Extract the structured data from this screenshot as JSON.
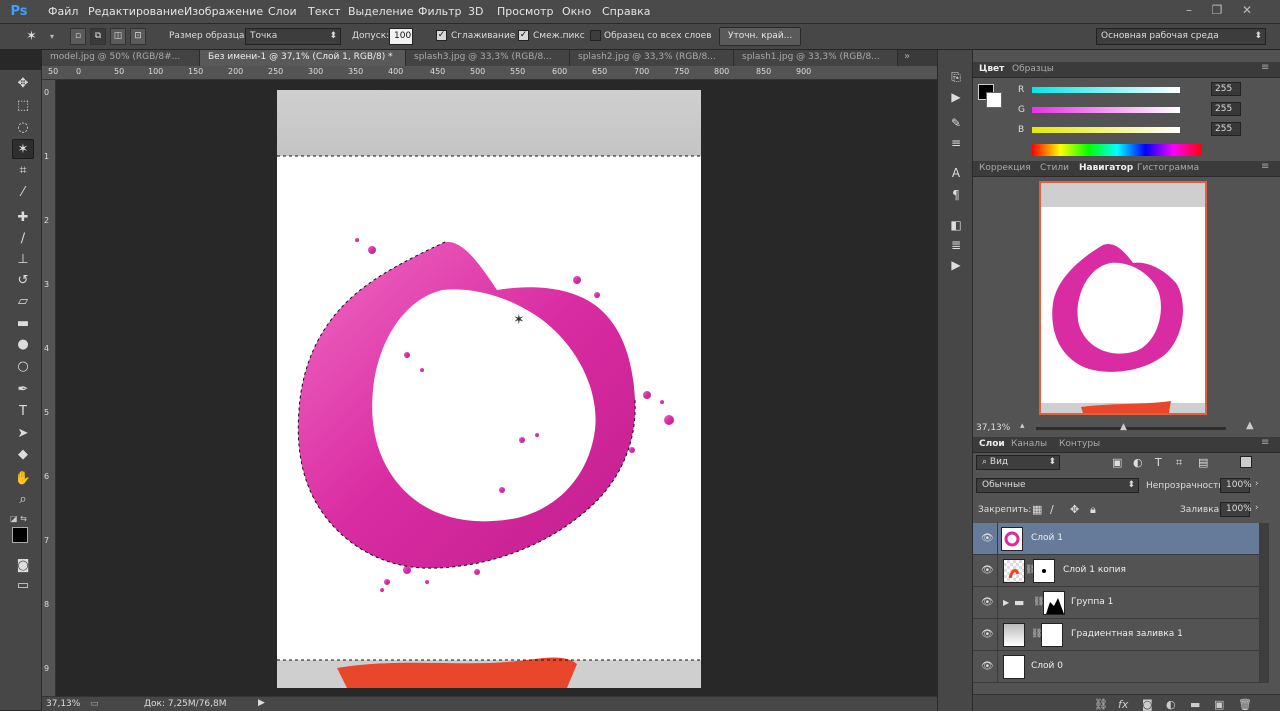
{
  "app": {
    "logo": "Ps"
  },
  "menu": [
    "Файл",
    "Редактирование",
    "Изображение",
    "Слои",
    "Текст",
    "Выделение",
    "Фильтр",
    "3D",
    "Просмотр",
    "Окно",
    "Справка"
  ],
  "window_controls": {
    "minimize": "–",
    "restore": "❐",
    "close": "✕"
  },
  "options": {
    "sample_size_label": "Размер образца:",
    "sample_size_value": "Точка",
    "tolerance_label": "Допуск:",
    "tolerance_value": "100",
    "antialias_label": "Сглаживание",
    "contiguous_label": "Смеж.пикс",
    "all_layers_label": "Образец со всех слоев",
    "refine_edge_label": "Уточн. край...",
    "workspace_value": "Основная рабочая среда"
  },
  "doc_tabs": [
    {
      "label": "model.jpg @ 50% (RGB/8#...",
      "active": false
    },
    {
      "label": "Без имени-1 @ 37,1% (Слой 1, RGB/8) *",
      "active": true
    },
    {
      "label": "splash3.jpg @ 33,3% (RGB/8...",
      "active": false
    },
    {
      "label": "splash2.jpg @ 33,3% (RGB/8...",
      "active": false
    },
    {
      "label": "splash1.jpg @ 33,3% (RGB/8...",
      "active": false
    }
  ],
  "ruler_top": [
    "50",
    "0",
    "50",
    "100",
    "150",
    "200",
    "250",
    "300",
    "350",
    "400",
    "450",
    "500",
    "550",
    "600",
    "650",
    "700",
    "750",
    "800",
    "850",
    "900"
  ],
  "ruler_left": [
    "0",
    "1",
    "2",
    "3",
    "4",
    "5",
    "6",
    "7",
    "8",
    "9"
  ],
  "status": {
    "zoom": "37,13%",
    "doc": "Док: 7,25M/76,8M"
  },
  "color_panel": {
    "tabs": [
      "Цвет",
      "Образцы"
    ],
    "channels": [
      {
        "name": "R",
        "value": "255",
        "color": "#00e0e0"
      },
      {
        "name": "G",
        "value": "255",
        "color": "#e040e0"
      },
      {
        "name": "B",
        "value": "255",
        "color": "#e8e800"
      }
    ]
  },
  "navigator_panel": {
    "tabs": [
      "Коррекция",
      "Стили",
      "Навигатор",
      "Гистограмма"
    ],
    "active_tab": "Навигатор",
    "zoom": "37,13%"
  },
  "layers_panel": {
    "tabs": [
      "Слои",
      "Каналы",
      "Контуры"
    ],
    "filter_label": "Вид",
    "blend_mode": "Обычные",
    "opacity_label": "Непрозрачность:",
    "opacity_value": "100%",
    "lock_label": "Закрепить:",
    "fill_label": "Заливка:",
    "fill_value": "100%",
    "layers": [
      {
        "name": "Слой 1",
        "selected": true
      },
      {
        "name": "Слой 1 копия",
        "selected": false
      },
      {
        "name": "Группа 1",
        "selected": false
      },
      {
        "name": "Градиентная заливка 1",
        "selected": false
      },
      {
        "name": "Слой 0",
        "selected": false
      }
    ]
  },
  "colors": {
    "magenta": "#e03aa8",
    "accent_blue": "#3fa0ff",
    "selection_row": "#667a99"
  }
}
